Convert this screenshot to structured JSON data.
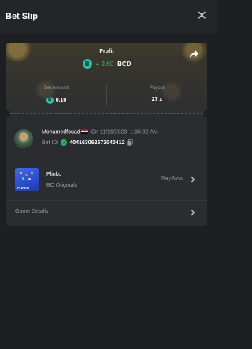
{
  "header": {
    "title": "Bet Slip",
    "close_icon": "close-icon"
  },
  "summary": {
    "profit_label": "Profit",
    "profit_value": "+ 2.60",
    "currency": "BCD",
    "coin_icon": "bcd-coin-icon",
    "bet_amount_label": "Bet Amount",
    "bet_amount_value": "0.10",
    "payout_label": "Payout",
    "payout_value": "27 x"
  },
  "user": {
    "name": "Mohamedfouad",
    "date_prefix": "On",
    "date": "11/28/2023, 1:35:32 AM",
    "bet_id_label": "Bet ID:",
    "bet_id": "404163062573040412"
  },
  "game": {
    "name": "Plinko",
    "provider": "BC Originals",
    "thumb_label": "PLINKO",
    "play_label": "Play Now"
  },
  "details": {
    "label": "Game Details"
  },
  "colors": {
    "accent": "#24c4a5",
    "profit": "#47b86a",
    "background": "#1e1f22",
    "card": "#2b2c30"
  }
}
